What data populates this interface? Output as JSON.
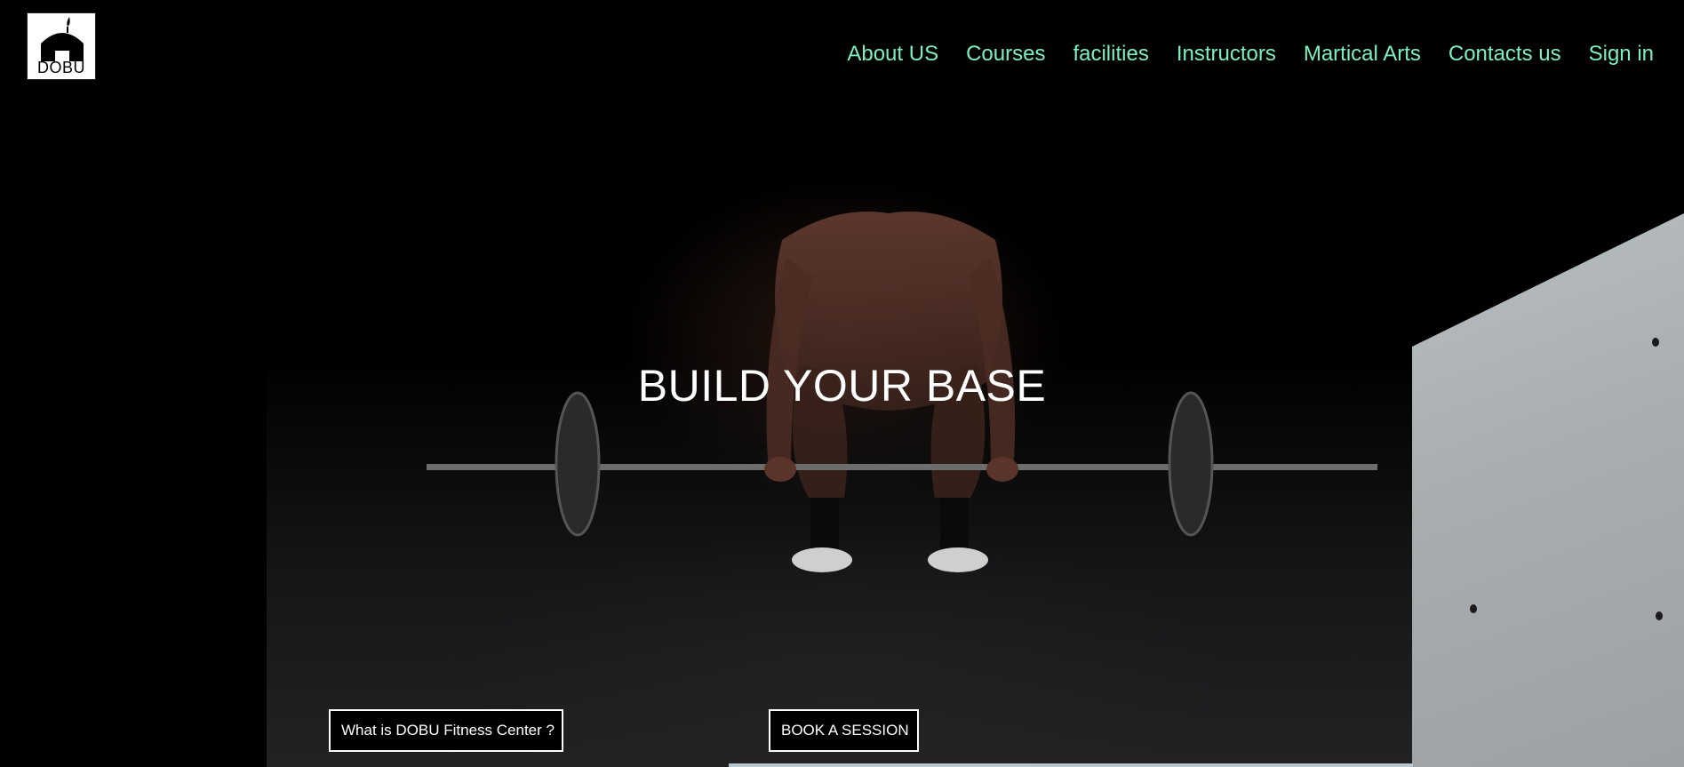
{
  "brand": {
    "logo_text": "DOBU",
    "logo_icon": "house-flame-logo-icon"
  },
  "nav": {
    "items": [
      {
        "label": "About US"
      },
      {
        "label": "Courses"
      },
      {
        "label": "facilities"
      },
      {
        "label": "Instructors"
      },
      {
        "label": "Martical Arts"
      },
      {
        "label": "Contacts us"
      },
      {
        "label": "Sign in"
      }
    ],
    "color": "#7cf0c0"
  },
  "hero": {
    "title": "BUILD YOUR BASE",
    "image": "man-deadlifting-barbell-in-dark-gym"
  },
  "buttons": {
    "what_is": "What is DOBU Fitness Center ?",
    "book": "BOOK A SESSION"
  }
}
